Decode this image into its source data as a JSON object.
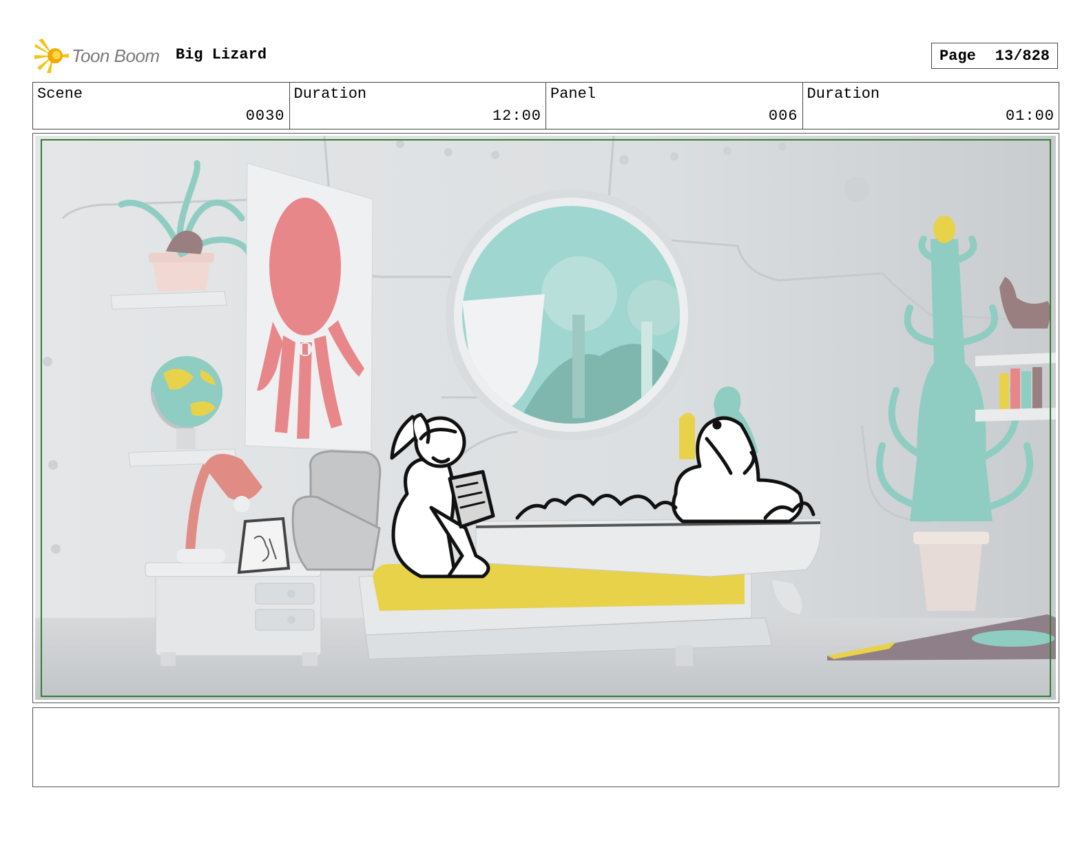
{
  "header": {
    "logo_text": "Toon Boom",
    "project_title": "Big Lizard",
    "page_label": "Page",
    "page_value": "13/828"
  },
  "info": [
    {
      "label": "Scene",
      "value": "0030"
    },
    {
      "label": "Duration",
      "value": "12:00"
    },
    {
      "label": "Panel",
      "value": "006"
    },
    {
      "label": "Duration",
      "value": "01:00"
    }
  ],
  "notes": "",
  "colors": {
    "logo_star": "#f5c518",
    "safe_frame": "#2e7d32",
    "octopus": "#e8878a",
    "window_water": "#9fd6d0",
    "tree": "#8fcdc2",
    "blanket": "#e8d24a",
    "wall": "#dcdfe1"
  },
  "icons": [
    "toon-boom-star-icon"
  ]
}
